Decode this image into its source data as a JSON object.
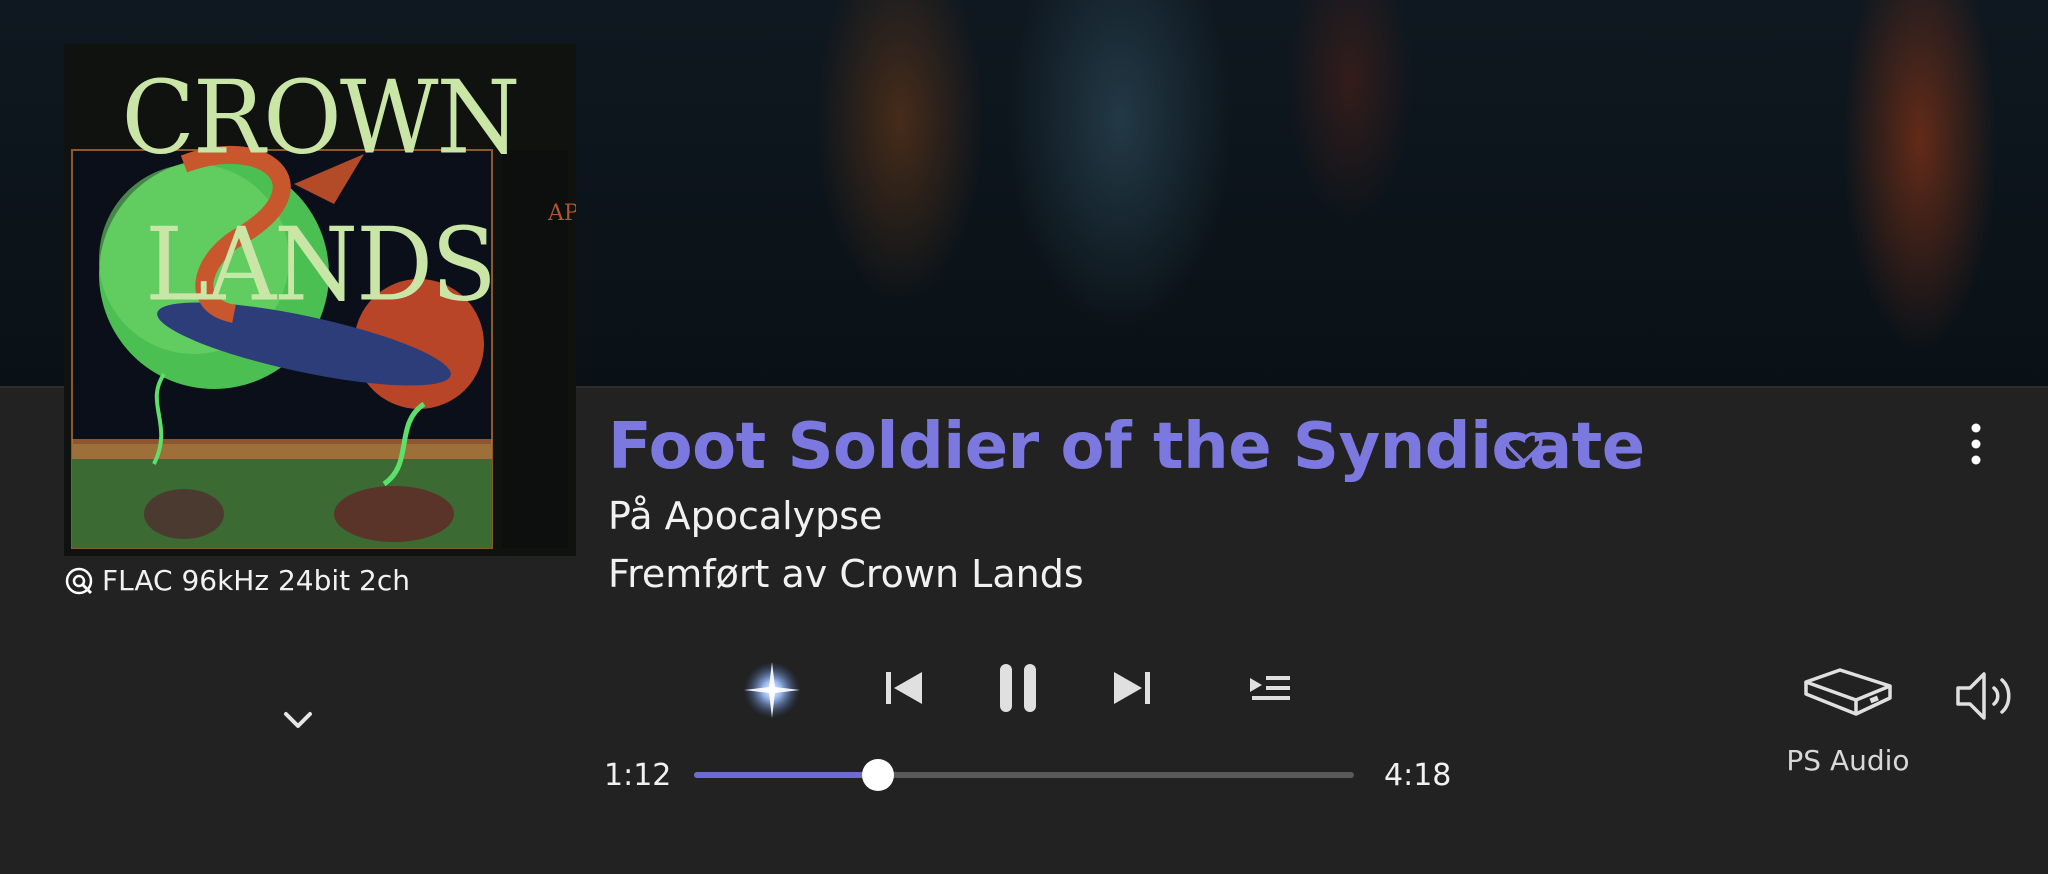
{
  "album_art": {
    "title_text": "CROWN LANDS",
    "side_text": "APOCALYPSE"
  },
  "audio_quality": "FLAC 96kHz 24bit 2ch",
  "track": {
    "title": "Foot Soldier of the Syndicate",
    "album": "På Apocalypse",
    "artist": "Fremført av Crown Lands"
  },
  "playback": {
    "current_time": "1:12",
    "total_time": "4:18",
    "progress": 0.279
  },
  "output_device": "PS Audio",
  "colors": {
    "accent": "#7b78e0",
    "background": "#222222",
    "progress_fill": "#6d6ad6",
    "progress_track": "#5a5a5a"
  },
  "icons": [
    "quality-icon",
    "collapse-chevron-icon",
    "heart-icon",
    "more-options-icon",
    "autoplay-sparkle-icon",
    "previous-icon",
    "pause-icon",
    "next-icon",
    "queue-icon",
    "device-icon",
    "volume-icon"
  ]
}
